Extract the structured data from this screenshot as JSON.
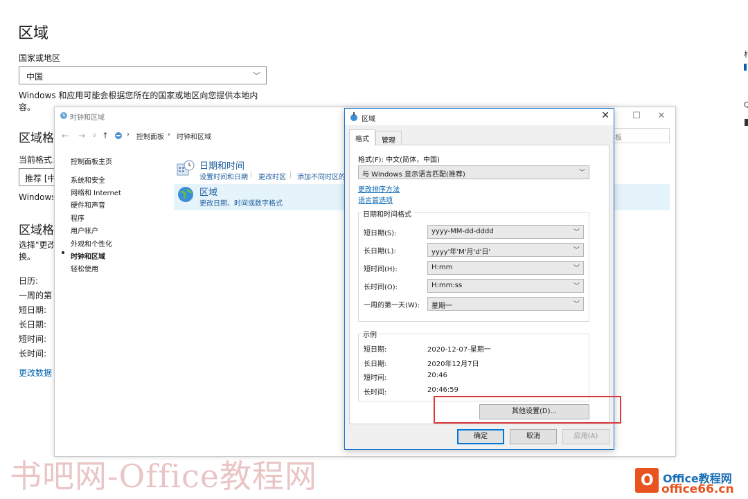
{
  "settings": {
    "title": "区域",
    "country_label": "国家或地区",
    "country_value": "中国",
    "country_desc": "Windows 和应用可能会根据您所在的国家或地区向您提供本地内容。",
    "format_heading": "区域格式",
    "current_format_label": "当前格式:",
    "format_combo_value": "推荐 [中",
    "windows_text": "Windows",
    "format_data_heading": "区域格式",
    "select_text": "选择\"更改",
    "select_text_2": "换。",
    "calendar_label": "日历:",
    "first_day_label": "一周的第",
    "short_date_label": "短日期:",
    "long_date_label": "长日期:",
    "short_time_label": "短时间:",
    "long_time_label": "长时间:",
    "change_format_link": "更改数据",
    "right_frag_1": "村",
    "right_frag_2": "Q"
  },
  "control_panel": {
    "title": "时钟和区域",
    "breadcrumb": [
      "控制面板",
      "时钟和区域"
    ],
    "search_placeholder": "板",
    "sidebar": [
      {
        "label": "控制面板主页",
        "current": false
      },
      {
        "label": "系统和安全",
        "current": false
      },
      {
        "label": "网络和 Internet",
        "current": false
      },
      {
        "label": "硬件和声音",
        "current": false
      },
      {
        "label": "程序",
        "current": false
      },
      {
        "label": "用户帐户",
        "current": false
      },
      {
        "label": "外观和个性化",
        "current": false
      },
      {
        "label": "时钟和区域",
        "current": true
      },
      {
        "label": "轻松使用",
        "current": false
      }
    ],
    "categories": [
      {
        "title": "日期和时间",
        "links": [
          "设置时间和日期",
          "更改时区",
          "添加不同时区的"
        ]
      },
      {
        "title": "区域",
        "links": [
          "更改日期、时间或数字格式"
        ]
      }
    ]
  },
  "dialog": {
    "title": "区域",
    "tabs": [
      "格式",
      "管理"
    ],
    "format_label": "格式(F): 中文(简体，中国)",
    "format_value": "与 Windows 显示语言匹配(推荐)",
    "links": [
      "更改排序方法",
      "语言首选项"
    ],
    "datetime_group_title": "日期和时间格式",
    "fields": [
      {
        "label": "短日期(S):",
        "value": "yyyy-MM-dd-dddd"
      },
      {
        "label": "长日期(L):",
        "value": "yyyy'年'M'月'd'日'"
      },
      {
        "label": "短时间(H):",
        "value": "H:mm"
      },
      {
        "label": "长时间(O):",
        "value": "H:mm:ss"
      },
      {
        "label": "一周的第一天(W):",
        "value": "星期一"
      }
    ],
    "examples_title": "示例",
    "examples": [
      {
        "label": "短日期:",
        "value": "2020-12-07-星期一"
      },
      {
        "label": "长日期:",
        "value": "2020年12月7日"
      },
      {
        "label": "短时间:",
        "value": "20:46"
      },
      {
        "label": "长时间:",
        "value": "20:46:59"
      }
    ],
    "other_settings": "其他设置(D)...",
    "ok": "确定",
    "cancel": "取消",
    "apply": "应用(A)"
  },
  "watermark": {
    "left_text": "书吧网-Office教程网",
    "logo_line1": "Office教程网",
    "logo_line2": "office66.cn",
    "colors": {
      "left": "#d79696",
      "logo_orange": "#e8531f",
      "logo_blue": "#1b6fb5"
    }
  },
  "colors": {
    "accent": "#0078d7",
    "link": "#0063b1",
    "highlight": "#e5f3fb",
    "red_box": "#d9383a"
  }
}
